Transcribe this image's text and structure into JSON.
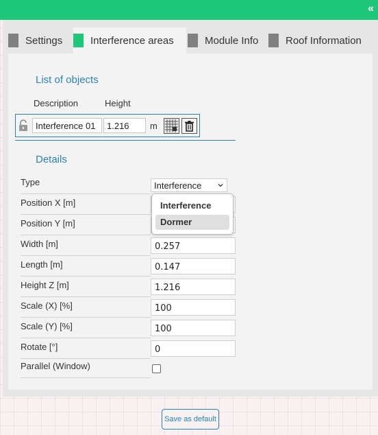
{
  "topbar": {
    "collapse_glyph": "«"
  },
  "tabs": [
    {
      "label": "Settings"
    },
    {
      "label": "Interference areas"
    },
    {
      "label": "Module Info"
    },
    {
      "label": "Roof Information"
    }
  ],
  "list": {
    "title": "List of objects",
    "col_description": "Description",
    "col_height": "Height",
    "row": {
      "description": "Interference 01",
      "height": "1.216",
      "unit": "m"
    }
  },
  "details": {
    "title": "Details",
    "type_label": "Type",
    "type_value": "Interference",
    "type_options": [
      "Interference",
      "Dormer"
    ],
    "fields": [
      {
        "label": "Position X [m]",
        "value": ""
      },
      {
        "label": "Position Y [m]",
        "value": ""
      },
      {
        "label": "Width [m]",
        "value": "0.257"
      },
      {
        "label": "Length [m]",
        "value": "0.147"
      },
      {
        "label": "Height Z [m]",
        "value": "1.216"
      },
      {
        "label": "Scale (X) [%]",
        "value": "100"
      },
      {
        "label": "Scale (Y) [%]",
        "value": "100"
      },
      {
        "label": "Rotate [°]",
        "value": "0"
      }
    ],
    "parallel_label": "Parallel (Window)"
  },
  "footer": {
    "default_button": "Save as default"
  },
  "colors": {
    "accent": "#1fc878",
    "link_blue": "#2b82b8",
    "tab_square": "#808080"
  }
}
